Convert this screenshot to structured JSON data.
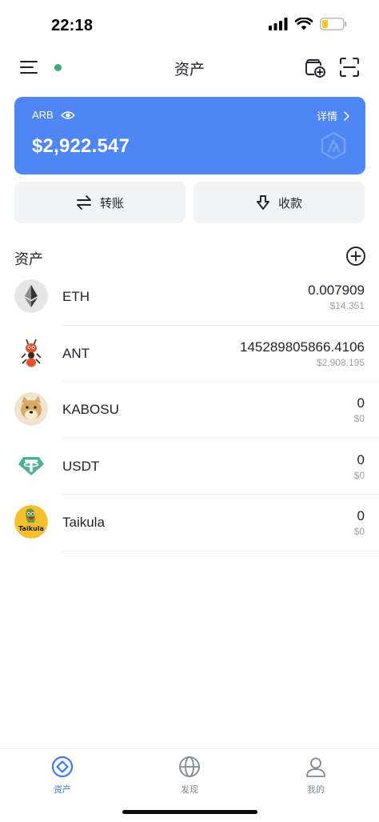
{
  "status_bar": {
    "time": "22:18"
  },
  "header": {
    "title": "资产"
  },
  "balance_card": {
    "network": "ARB",
    "detail_label": "详情",
    "balance": "$2,922.547",
    "accent_color": "#4e86f4"
  },
  "actions": {
    "transfer_label": "转账",
    "receive_label": "收款"
  },
  "assets": {
    "title": "资产",
    "tokens": [
      {
        "symbol": "ETH",
        "amount": "0.007909",
        "value": "$14.351",
        "icon": "ethereum-icon"
      },
      {
        "symbol": "ANT",
        "amount": "145289805866.4106",
        "value": "$2,908.195",
        "icon": "ant-token-icon"
      },
      {
        "symbol": "KABOSU",
        "amount": "0",
        "value": "$0",
        "icon": "kabosu-dog-icon"
      },
      {
        "symbol": "USDT",
        "amount": "0",
        "value": "$0",
        "icon": "tether-icon"
      },
      {
        "symbol": "Taikula",
        "amount": "0",
        "value": "$0",
        "icon": "taikula-icon"
      }
    ]
  },
  "tab_bar": {
    "tabs": [
      {
        "label": "资产",
        "icon": "assets-icon",
        "active": true
      },
      {
        "label": "发现",
        "icon": "globe-icon",
        "active": false
      },
      {
        "label": "我的",
        "icon": "user-icon",
        "active": false
      }
    ],
    "active_color": "#3b7bf2"
  }
}
